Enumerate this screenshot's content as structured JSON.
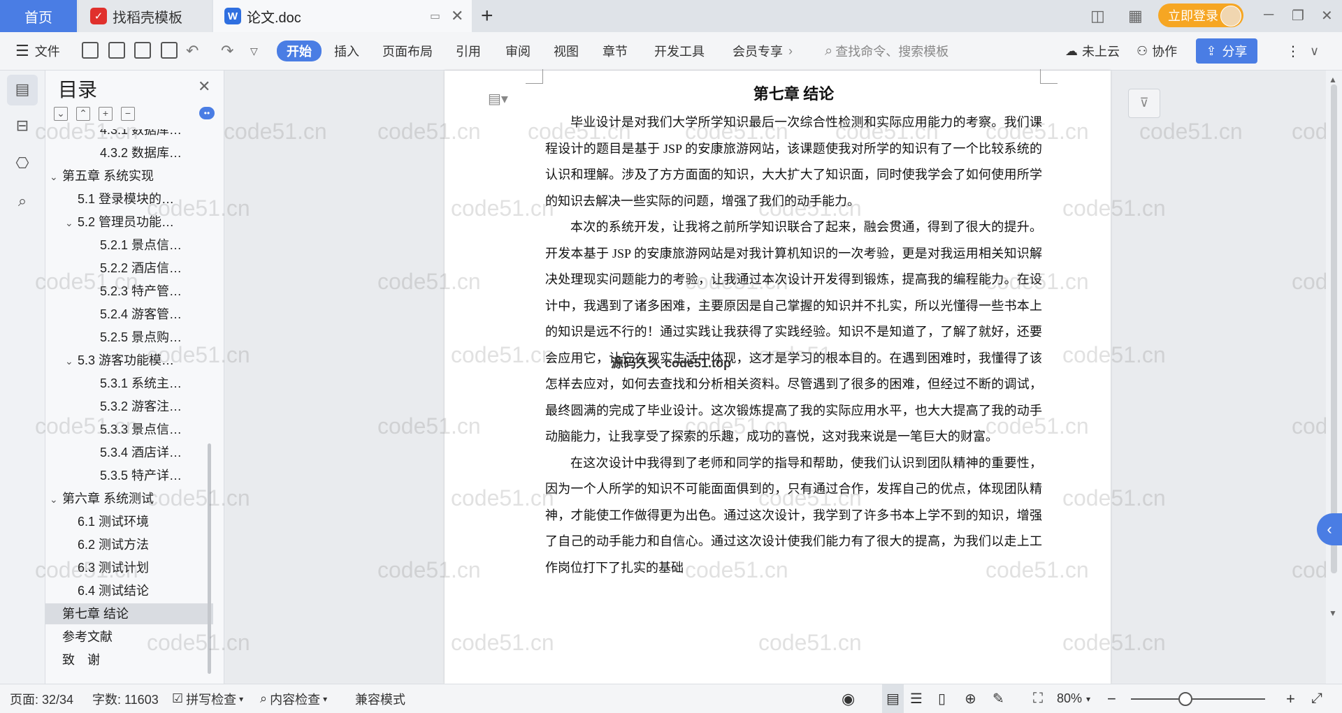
{
  "titlebar": {
    "tabs": [
      {
        "label": "首页"
      },
      {
        "label": "找稻壳模板"
      },
      {
        "label": "论文.doc"
      }
    ],
    "login_label": "立即登录"
  },
  "ribbon": {
    "file_label": "文件",
    "tabs": [
      "开始",
      "插入",
      "页面布局",
      "引用",
      "审阅",
      "视图",
      "章节",
      "开发工具",
      "会员专享"
    ],
    "search_placeholder": "查找命令、搜索模板",
    "cloud_label": "未上云",
    "collab_label": "协作",
    "share_label": "分享"
  },
  "toc": {
    "title": "目录",
    "items": [
      {
        "label": "4.3.1 数据库…",
        "level": 3
      },
      {
        "label": "4.3.2 数据库…",
        "level": 3
      },
      {
        "label": "第五章 系统实现",
        "level": 1,
        "expanded": true
      },
      {
        "label": "5.1 登录模块的…",
        "level": 2
      },
      {
        "label": "5.2 管理员功能…",
        "level": 2,
        "expanded": true
      },
      {
        "label": "5.2.1 景点信…",
        "level": 3
      },
      {
        "label": "5.2.2 酒店信…",
        "level": 3
      },
      {
        "label": "5.2.3 特产管…",
        "level": 3
      },
      {
        "label": "5.2.4 游客管…",
        "level": 3
      },
      {
        "label": "5.2.5 景点购…",
        "level": 3
      },
      {
        "label": "5.3 游客功能模…",
        "level": 2,
        "expanded": true
      },
      {
        "label": "5.3.1 系统主…",
        "level": 3
      },
      {
        "label": "5.3.2 游客注…",
        "level": 3
      },
      {
        "label": "5.3.3 景点信…",
        "level": 3
      },
      {
        "label": "5.3.4 酒店详…",
        "level": 3
      },
      {
        "label": "5.3.5 特产详…",
        "level": 3
      },
      {
        "label": "第六章 系统测试",
        "level": 1,
        "expanded": true
      },
      {
        "label": "6.1 测试环境",
        "level": 2
      },
      {
        "label": "6.2 测试方法",
        "level": 2
      },
      {
        "label": "6.3 测试计划",
        "level": 2
      },
      {
        "label": "6.4 测试结论",
        "level": 2
      },
      {
        "label": "第七章 结论",
        "level": 1,
        "selected": true
      },
      {
        "label": "参考文献",
        "level": 1
      },
      {
        "label": "致　谢",
        "level": 1
      }
    ]
  },
  "document": {
    "chapter_title": "第七章  结论",
    "paragraphs": [
      "毕业设计是对我们大学所学知识最后一次综合性检测和实际应用能力的考察。我们课程设计的题目是基于 JSP 的安康旅游网站，该课题使我对所学的知识有了一个比较系统的认识和理解。涉及了方方面面的知识，大大扩大了知识面，同时使我学会了如何使用所学的知识去解决一些实际的问题，增强了我们的动手能力。",
      "本次的系统开发，让我将之前所学知识联合了起来，融会贯通，得到了很大的提升。开发本基于 JSP 的安康旅游网站是对我计算机知识的一次考验，更是对我运用相关知识解决处理现实问题能力的考验，让我通过本次设计开发得到锻炼，提高我的编程能力。在设计中，我遇到了诸多困难，主要原因是自己掌握的知识并不扎实，所以光懂得一些书本上的知识是远不行的！通过实践让我获得了实践经验。知识不是知道了，了解了就好，还要会应用它，让它在现实生活中体现，这才是学习的根本目的。在遇到困难时，我懂得了该怎样去应对，如何去查找和分析相关资料。尽管遇到了很多的困难，但经过不断的调试，最终圆满的完成了毕业设计。这次锻炼提高了我的实际应用水平，也大大提高了我的动手动脑能力，让我享受了探索的乐趣，成功的喜悦，这对我来说是一笔巨大的财富。",
      "在这次设计中我得到了老师和同学的指导和帮助，使我们认识到团队精神的重要性，因为一个人所学的知识不可能面面俱到的，只有通过合作，发挥自己的优点，体现团队精神，才能使工作做得更为出色。通过这次设计，我学到了许多书本上学不到的知识，增强了自己的动手能力和自信心。通过这次设计使我们能力有了很大的提高，为我们以走上工作岗位打下了扎实的基础"
    ],
    "watermark_text": "code51.cn",
    "overlay_text": "源码久久 code51.top"
  },
  "status": {
    "page": "页面: 32/34",
    "words": "字数: 11603",
    "spell": "拼写检查",
    "content_check": "内容检查",
    "compat": "兼容模式",
    "zoom": "80%"
  },
  "colors": {
    "accent": "#4a7de4",
    "login": "#f6a623"
  }
}
